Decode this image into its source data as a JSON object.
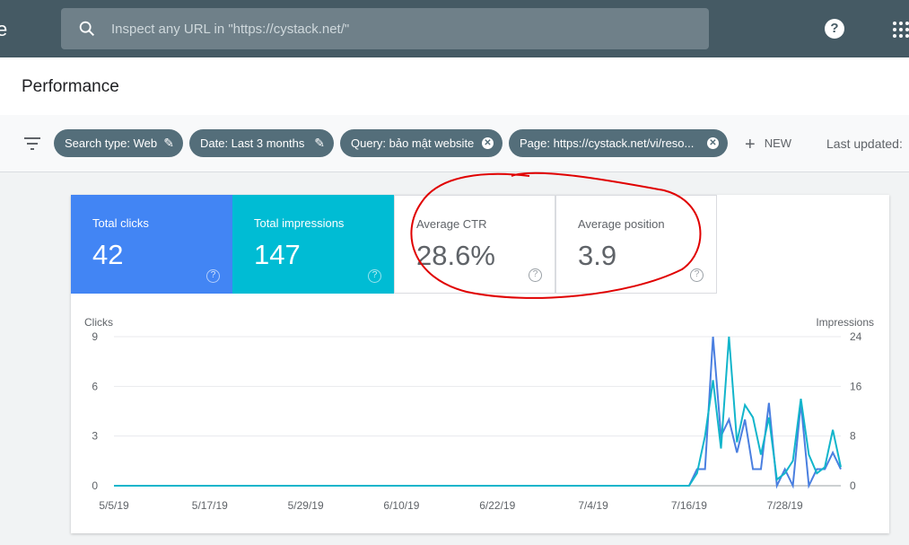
{
  "topbar": {
    "brand_fragment": "e",
    "search_placeholder": "Inspect any URL in \"https://cystack.net/\"",
    "help_label": "?"
  },
  "header": {
    "title": "Performance"
  },
  "filters": {
    "chips": [
      {
        "label": "Search type: Web",
        "action": "edit"
      },
      {
        "label": "Date: Last 3 months",
        "action": "edit"
      },
      {
        "label": "Query: bảo mật website",
        "action": "remove"
      },
      {
        "label": "Page: https://cystack.net/vi/reso...",
        "action": "remove"
      }
    ],
    "new_label": "NEW",
    "last_updated": "Last updated:"
  },
  "metrics": [
    {
      "label": "Total clicks",
      "value": "42",
      "color": "#4285f4"
    },
    {
      "label": "Total impressions",
      "value": "147",
      "color": "#00bcd4"
    },
    {
      "label": "Average CTR",
      "value": "28.6%"
    },
    {
      "label": "Average position",
      "value": "3.9"
    }
  ],
  "annotation_color": "#e00000",
  "chart_data": {
    "type": "line",
    "ylabel_left": "Clicks",
    "ylabel_right": "Impressions",
    "yticks_left": [
      "0",
      "3",
      "6",
      "9"
    ],
    "ylim_left": [
      0,
      9
    ],
    "yticks_right": [
      "0",
      "8",
      "16",
      "24"
    ],
    "ylim_right": [
      0,
      24
    ],
    "xticks": [
      "5/5/19",
      "5/17/19",
      "5/29/19",
      "6/10/19",
      "6/22/19",
      "7/4/19",
      "7/16/19",
      "7/28/19"
    ],
    "xlim": [
      "5/5/19",
      "8/4/19"
    ],
    "grid": true,
    "series": [
      {
        "name": "Clicks",
        "axis": "left",
        "color": "#4a7fe0",
        "values": [
          0,
          0,
          0,
          0,
          0,
          0,
          0,
          0,
          0,
          0,
          0,
          0,
          0,
          0,
          0,
          0,
          0,
          0,
          0,
          0,
          0,
          0,
          0,
          0,
          0,
          0,
          0,
          0,
          0,
          0,
          0,
          0,
          0,
          0,
          0,
          0,
          0,
          0,
          0,
          0,
          0,
          0,
          0,
          0,
          0,
          0,
          0,
          0,
          0,
          0,
          0,
          0,
          0,
          0,
          0,
          0,
          0,
          0,
          0,
          0,
          0,
          0,
          0,
          0,
          0,
          0,
          0,
          0,
          0,
          0,
          0,
          0,
          0,
          1,
          1,
          9,
          3,
          4,
          2,
          4,
          1,
          1,
          5,
          0,
          1,
          0,
          5,
          0,
          1,
          1,
          2,
          1
        ]
      },
      {
        "name": "Impressions",
        "axis": "right",
        "color": "#12b5cb",
        "values": [
          0,
          0,
          0,
          0,
          0,
          0,
          0,
          0,
          0,
          0,
          0,
          0,
          0,
          0,
          0,
          0,
          0,
          0,
          0,
          0,
          0,
          0,
          0,
          0,
          0,
          0,
          0,
          0,
          0,
          0,
          0,
          0,
          0,
          0,
          0,
          0,
          0,
          0,
          0,
          0,
          0,
          0,
          0,
          0,
          0,
          0,
          0,
          0,
          0,
          0,
          0,
          0,
          0,
          0,
          0,
          0,
          0,
          0,
          0,
          0,
          0,
          0,
          0,
          0,
          0,
          0,
          0,
          0,
          0,
          0,
          0,
          0,
          0,
          2,
          8,
          17,
          6,
          24,
          7,
          13,
          11,
          5,
          11,
          1,
          2,
          4,
          14,
          5,
          2,
          3,
          9,
          3
        ]
      }
    ]
  }
}
